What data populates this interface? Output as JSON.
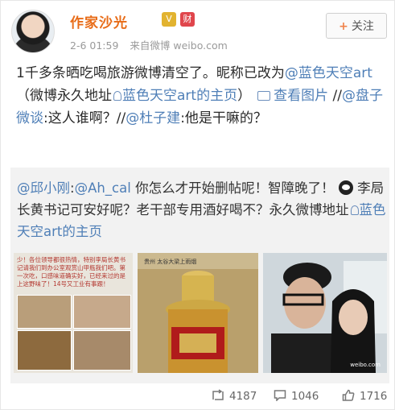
{
  "post": {
    "author_name": "作家沙光",
    "badge_v": "V",
    "badge_red": "财",
    "meta_time": "2-6 01:59",
    "meta_source": "来自微博 weibo.com",
    "follow_label": "关注",
    "text_1": "1千多条晒吃喝旅游微博清空了。昵称已改为",
    "mention_1": "@蓝色天空art",
    "text_2": "（微博永久地址",
    "link_1": "蓝色天空art的主页",
    "text_3": "）",
    "link_pic": "查看图片",
    "text_4": "//",
    "mention_2": "@盘子微谈",
    "text_5": ":这人谁啊？//",
    "mention_3": "@杜子建",
    "text_6": ":他是干嘛的？"
  },
  "repost": {
    "mention_1": "@邱小刚",
    "text_1": ":",
    "mention_2": "@Ah_cal",
    "text_2": " 你怎么才开始删帖呢！智障晚了！",
    "text_3": "李局长黄书记可安好呢？老干部专用酒好喝不？永久微博地址",
    "link_1": "蓝色天空art的主页",
    "pic1_caption": "少！各位领导都很热情，特别李局长黄书记请我们到办公室观赏山甲瓶我们吧。第一次吃，口感味道确实好，已经来过的是上这野味了！14号又工业有事跟！",
    "pic2_caption": "贵州 太谷大梁上雨烟",
    "pic3_watermark": "weibo.com"
  },
  "stats": {
    "reposts": "4187",
    "comments": "1046",
    "likes": "1716"
  },
  "colors": {
    "name": "#e86c18",
    "link": "#4f7fb7",
    "repost_bg": "#f2f2f2"
  }
}
